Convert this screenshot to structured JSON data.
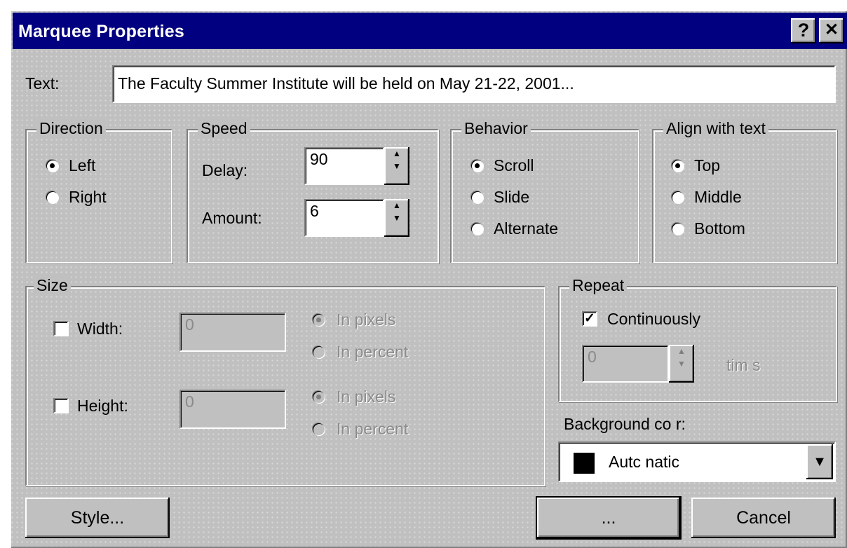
{
  "window": {
    "title": "Marquee Properties",
    "help_glyph": "?",
    "close_glyph": "✕"
  },
  "text_field": {
    "label": "Text:",
    "value": "The Faculty Summer Institute will be held on May 21-22, 2001..."
  },
  "direction": {
    "legend": "Direction",
    "options": [
      {
        "label": "Left",
        "checked": true
      },
      {
        "label": "Right",
        "checked": false
      }
    ]
  },
  "speed": {
    "legend": "Speed",
    "delay_label": "Delay:",
    "delay_value": "90",
    "amount_label": "Amount:",
    "amount_value": "6"
  },
  "behavior": {
    "legend": "Behavior",
    "options": [
      {
        "label": "Scroll",
        "checked": true
      },
      {
        "label": "Slide",
        "checked": false
      },
      {
        "label": "Alternate",
        "checked": false
      }
    ]
  },
  "align": {
    "legend": "Align with text",
    "options": [
      {
        "label": "Top",
        "checked": true
      },
      {
        "label": "Middle",
        "checked": false
      },
      {
        "label": "Bottom",
        "checked": false
      }
    ]
  },
  "size": {
    "legend": "Size",
    "width_label": "Width:",
    "width_value": "0",
    "width_checked": false,
    "height_label": "Height:",
    "height_value": "0",
    "height_checked": false,
    "unit_pixels": "In pixels",
    "unit_percent": "In percent"
  },
  "repeat": {
    "legend": "Repeat",
    "continuously_label": "Continuously",
    "continuously_checked": true,
    "times_value": "0",
    "times_label": "tim  s"
  },
  "background": {
    "label": "Background co  r:",
    "value": "Autc  natic",
    "swatch_color": "#000000"
  },
  "buttons": {
    "style": "Style...",
    "ok": " ...",
    "cancel": "Cancel"
  },
  "colors": {
    "titlebar": "#000080",
    "face": "#c0c0c0",
    "disabled_text": "#8a8a8a"
  }
}
